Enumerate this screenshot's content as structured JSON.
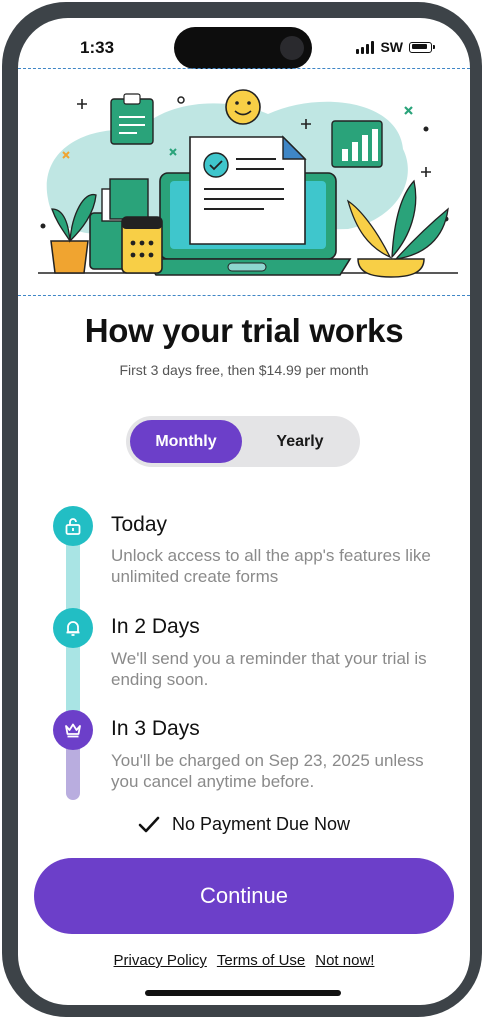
{
  "status_bar": {
    "time": "1:33",
    "carrier": "SW"
  },
  "header": {
    "title": "How your trial works",
    "subtitle": "First 3 days free, then $14.99 per month"
  },
  "plan_toggle": {
    "options": [
      "Monthly",
      "Yearly"
    ],
    "selected": "Monthly"
  },
  "timeline": [
    {
      "title": "Today",
      "description": "Unlock access to all the app's features like unlimited create forms",
      "icon": "unlock-icon",
      "color": "#22bec4"
    },
    {
      "title": "In 2 Days",
      "description": "We'll send you a reminder that your trial is ending soon.",
      "icon": "bell-icon",
      "color": "#22bec4"
    },
    {
      "title": "In 3 Days",
      "description": "You'll be charged on Sep 23, 2025 unless you cancel anytime before.",
      "icon": "crown-icon",
      "color": "#6c3fc9"
    }
  ],
  "no_payment": "No Payment Due Now",
  "cta": {
    "label": "Continue"
  },
  "footer_links": [
    "Privacy Policy",
    "Terms of Use",
    "Not now!"
  ],
  "colors": {
    "accent": "#6c3fc9",
    "teal": "#22bec4",
    "device_frame": "#3d4348"
  }
}
